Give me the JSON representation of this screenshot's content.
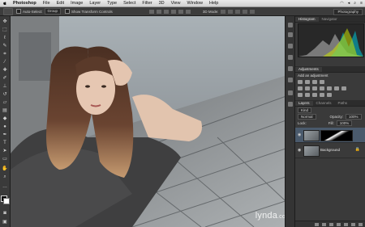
{
  "menubar": {
    "app": "Photoshop",
    "items": [
      "File",
      "Edit",
      "Image",
      "Layer",
      "Type",
      "Select",
      "Filter",
      "3D",
      "View",
      "Window",
      "Help"
    ]
  },
  "options": {
    "auto_select_label": "Auto-Select:",
    "auto_select_value": "Group",
    "transform_label": "Show Transform Controls",
    "mode3d_label": "3D Mode:",
    "workspace": "Photography"
  },
  "panels": {
    "top_tabs": [
      "Histogram",
      "Navigator"
    ],
    "adjustments_tab": "Adjustments",
    "add_adjustment": "Add an adjustment",
    "layer_tabs": [
      "Layers",
      "Channels",
      "Paths"
    ],
    "kind": "Kind",
    "blend_mode": "Normal",
    "opacity_label": "Opacity:",
    "opacity_value": "100%",
    "lock_label": "Lock:",
    "fill_label": "Fill:",
    "fill_value": "100%",
    "layers": [
      {
        "name": ""
      },
      {
        "name": "Background"
      }
    ]
  },
  "watermark": {
    "text": "lynda",
    "suffix": ".com"
  }
}
